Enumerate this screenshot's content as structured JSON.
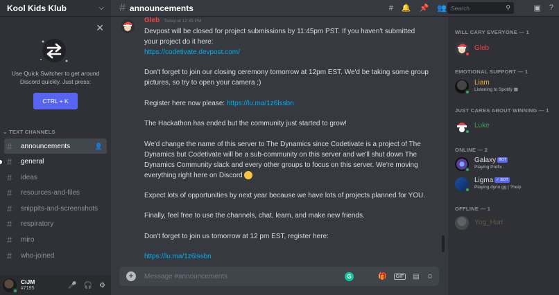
{
  "server": {
    "name": "Kool Kids Klub"
  },
  "quick_switcher": {
    "text": "Use Quick Switcher to get around Discord quickly. Just press:",
    "button": "CTRL + K"
  },
  "category": "TEXT CHANNELS",
  "channels": [
    {
      "name": "announcements"
    },
    {
      "name": "general"
    },
    {
      "name": "ideas"
    },
    {
      "name": "resources-and-files"
    },
    {
      "name": "snippits-and-screenshots"
    },
    {
      "name": "respiratory"
    },
    {
      "name": "miro"
    },
    {
      "name": "who-joined"
    }
  ],
  "user": {
    "name": "CiJM",
    "tag": "#7195"
  },
  "topbar": {
    "channel": "announcements",
    "search_placeholder": "Search"
  },
  "message": {
    "author": "Gleb",
    "time": "Today at 12:45 PM",
    "lines": [
      "Devpost will be closed for project submissions by 11:45pm PST. If you haven't submitted your project do it here:",
      "https://codetivate.devpost.com/",
      "Don't forget to join our closing ceremony tomorrow at 12pm EST. We'd be taking some group pictures, so try to open your camera ;)",
      "Register here now please: ",
      "https://lu.ma/1z6lssbn",
      "The Hackathon has ended but the community just started to grow!",
      "We'd change the name of this server to The Dynamics since Codetivate is a project of The Dynamics but Codetivate will be a sub-community on this server and we'll shut down The Dynamics Community slack and every other groups to focus on this server. We're moving everything right here on Discord",
      "Expect lots of opportunities by next year because we have lots of projects planned for YOU.",
      "Finally, feel free to use the channels, chat, learn, and make new friends.",
      "Don't forget to join us tomorrow at 12 pm EST, register here:",
      "https://lu.ma/1z6lssbn"
    ]
  },
  "composer": {
    "placeholder": "Message #announcements",
    "gif": "GIF"
  },
  "members": {
    "groups": [
      {
        "label": "WILL CARY EVERYONE — 1"
      },
      {
        "label": "EMOTIONAL SUPPORT — 1"
      },
      {
        "label": "JUST CARES ABOUT WINNING — 1"
      },
      {
        "label": "ONLINE — 2"
      },
      {
        "label": "OFFLINE — 1"
      }
    ],
    "list": [
      {
        "name": "Gleb",
        "color": "#ed4245"
      },
      {
        "name": "Liam",
        "color": "#f0b232",
        "sub": "Listening to Spotify"
      },
      {
        "name": "Luke",
        "color": "#3ba55d"
      },
      {
        "name": "Galaxy",
        "color": "#dcddde",
        "badge": "BOT",
        "sub": "Playing Prefix ."
      },
      {
        "name": "Ligma",
        "color": "#dcddde",
        "badge": "✓ BOT",
        "sub": "Playing dyno.gg | ?help"
      },
      {
        "name": "Yog_Hurt",
        "color": "#c7a64a"
      }
    ]
  },
  "colors": {
    "accent": "#5865f2",
    "link": "#00aff4",
    "mention_red": "#ed4245"
  }
}
